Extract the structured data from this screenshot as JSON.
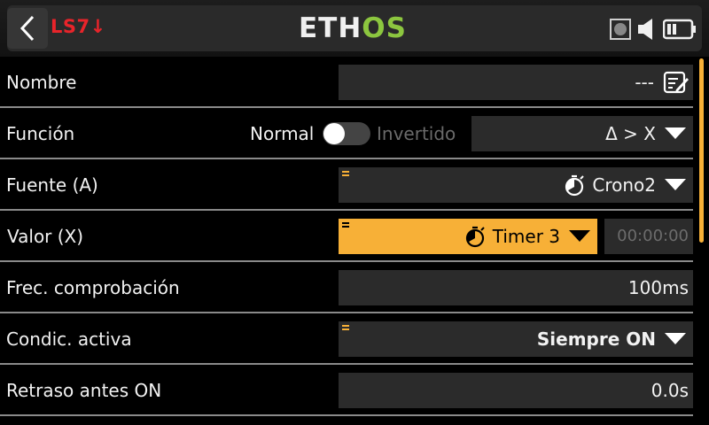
{
  "header": {
    "title": "LS7↓",
    "logo_part1": "ETH",
    "logo_part2": "OS"
  },
  "rows": [
    {
      "label": "Nombre",
      "value": "---"
    },
    {
      "label": "Función",
      "toggle_left": "Normal",
      "toggle_right": "Invertido",
      "value": "Δ > X"
    },
    {
      "label": "Fuente (A)",
      "value": "Crono2"
    },
    {
      "label": "Valor (X)",
      "value": "Timer 3",
      "extra": "00:00:00"
    },
    {
      "label": "Frec. comprobación",
      "value": "100ms"
    },
    {
      "label": "Condic. activa",
      "value": "Siempre ON"
    },
    {
      "label": "Retraso antes ON",
      "value": "0.0s"
    }
  ],
  "colors": {
    "accent": "#f7b037",
    "title_red": "#e8242a",
    "logo_green": "#8cc63f",
    "field_bg": "#2b2b2b"
  },
  "icons": [
    "back-arrow-icon",
    "record-icon",
    "speaker-icon",
    "battery-icon",
    "edit-text-icon",
    "timer-icon",
    "chevron-down-icon",
    "menu-mark-icon"
  ]
}
